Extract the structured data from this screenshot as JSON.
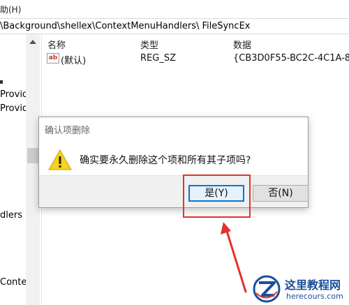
{
  "menubar": {
    "help_label": "助(H)"
  },
  "address": {
    "path": "\\Background\\shellex\\ContextMenuHandlers\\ FileSyncEx"
  },
  "tree": {
    "items": [
      "Provid",
      "Provid",
      "dlers",
      "Contex"
    ]
  },
  "list": {
    "columns": [
      "名称",
      "类型",
      "数据"
    ],
    "rows": [
      {
        "icon": "string-value-icon",
        "icon_text": "ab",
        "name": "(默认)",
        "type": "REG_SZ",
        "data": "{CB3D0F55-BC2C-4C1A-8"
      }
    ]
  },
  "dialog": {
    "title": "确认项删除",
    "message": "确实要永久删除这个项和所有其子项吗?",
    "icon": "warning-icon",
    "yes_label": "是(Y)",
    "no_label": "否(N)"
  },
  "watermark": {
    "title": "这里教程网",
    "url": "herecours.com"
  },
  "colors": {
    "highlight": "#e3312d",
    "focus": "#0078d7",
    "watermark": "#1a4e9c"
  }
}
